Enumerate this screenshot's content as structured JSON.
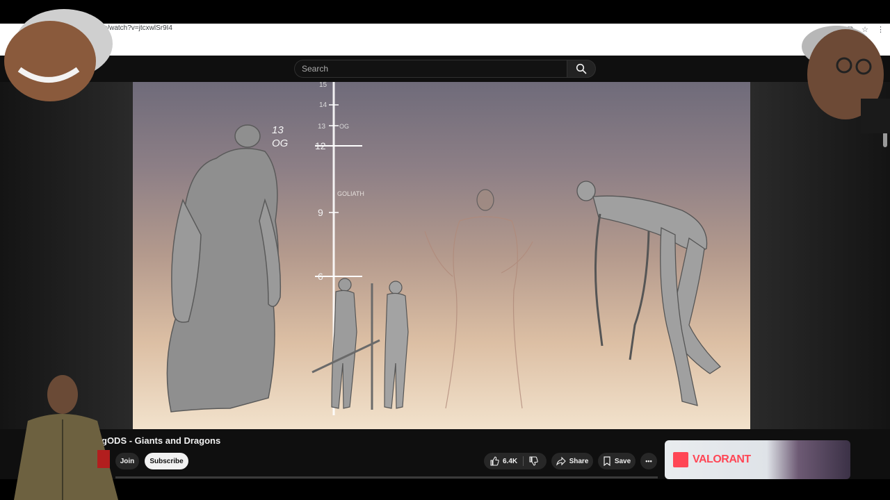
{
  "browser": {
    "url": "m/watch?v=jtcxwlSr9I4"
  },
  "search": {
    "placeholder": "Search"
  },
  "video": {
    "title": "gODS - Giants and Dragons",
    "scale_labels": [
      "15",
      "14",
      "13",
      "12",
      "9",
      "6"
    ],
    "annotations": {
      "og_scale": "OG",
      "goliath": "GOLIATH",
      "og_top": "13",
      "og_bottom": "OG"
    }
  },
  "channel": {
    "join_label": "Join",
    "subscribe_label": "Subscribe"
  },
  "actions": {
    "like_count": "6.4K",
    "share_label": "Share",
    "save_label": "Save",
    "more_label": "•••"
  },
  "ad": {
    "brand": "VALORANT",
    "accent_color": "#ff4655"
  },
  "icons": [
    "search-icon",
    "like-icon",
    "dislike-icon",
    "share-icon",
    "save-icon",
    "more-icon",
    "cast-icon",
    "star-icon",
    "menu-icon"
  ]
}
